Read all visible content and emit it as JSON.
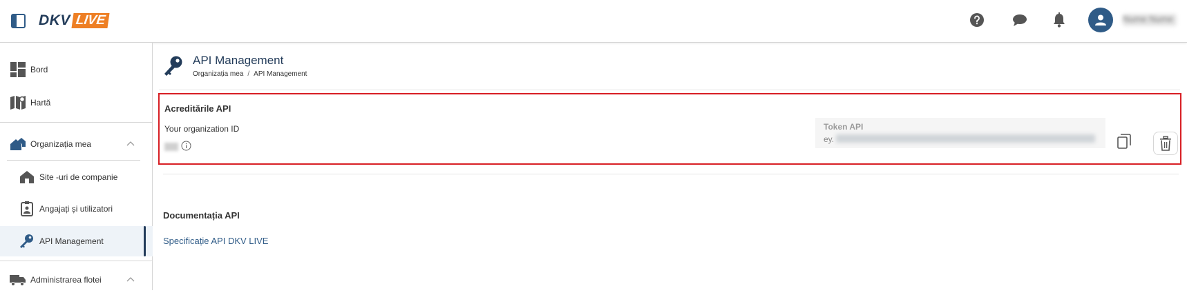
{
  "header": {
    "logo_text": "DKV",
    "logo_badge": "LIVE",
    "user_name": "Nume Nume",
    "icons": [
      "help-icon",
      "chat-icon",
      "bell-icon",
      "user-icon"
    ]
  },
  "sidebar": {
    "items": [
      {
        "label": "Bord",
        "icon": "dashboard-icon"
      },
      {
        "label": "Hartă",
        "icon": "map-icon"
      },
      {
        "label": "Organizația mea",
        "icon": "organization-icon",
        "expanded": true
      },
      {
        "label": "Site -uri de companie",
        "icon": "company-site-icon"
      },
      {
        "label": "Angajați și utilizatori",
        "icon": "employee-badge-icon"
      },
      {
        "label": "API Management",
        "icon": "key-icon",
        "active": true
      },
      {
        "label": "Administrarea flotei",
        "icon": "truck-icon",
        "expanded": true
      }
    ]
  },
  "page": {
    "title": "API Management",
    "breadcrumb": [
      "Organizația mea",
      "API Management"
    ],
    "breadcrumb_sep": "/"
  },
  "credentials": {
    "title": "Acreditările API",
    "org_id_label": "Your organization ID",
    "token_label": "Token API",
    "token_prefix": "ey."
  },
  "docs": {
    "title": "Documentația API",
    "link_text": "Specificație API DKV LIVE"
  },
  "colors": {
    "brand_navy": "#233c5a",
    "brand_orange": "#ee7f24",
    "highlight_red": "#d81e24",
    "link_blue": "#2f5b87"
  }
}
